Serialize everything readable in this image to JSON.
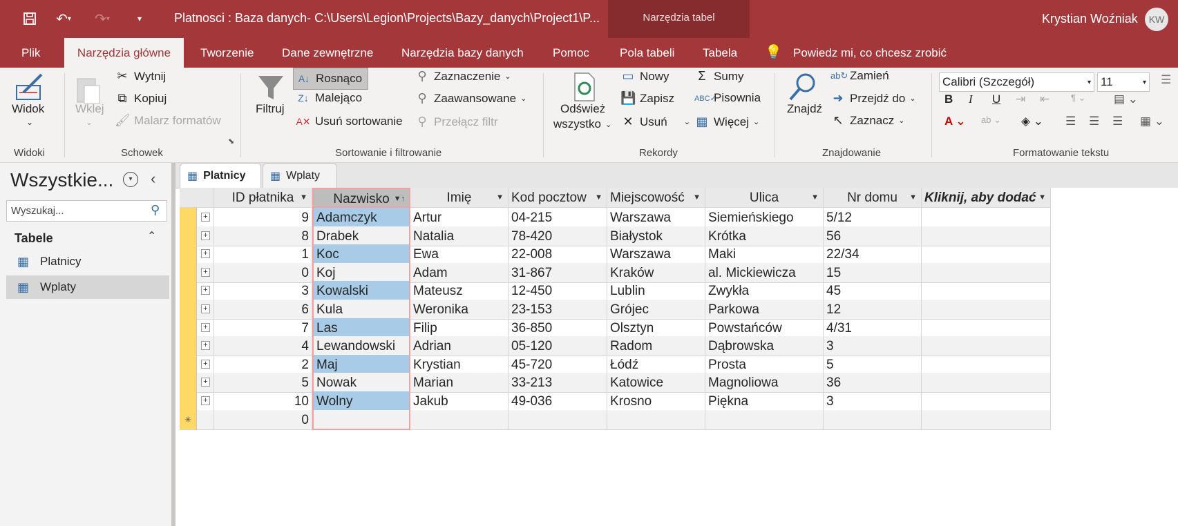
{
  "window": {
    "title": "Platnosci : Baza danych- C:\\Users\\Legion\\Projects\\Bazy_danych\\Project1\\P...",
    "context_group": "Narzędzia tabel",
    "user_name": "Krystian Woźniak",
    "user_initials": "KW"
  },
  "tabs": [
    "Plik",
    "Narzędzia główne",
    "Tworzenie",
    "Dane zewnętrzne",
    "Narzędzia bazy danych",
    "Pomoc",
    "Pola tabeli",
    "Tabela"
  ],
  "tell_me": "Powiedz mi, co chcesz zrobić",
  "ribbon": {
    "views": {
      "widok": "Widok",
      "group": "Widoki"
    },
    "clipboard": {
      "paste": "Wklej",
      "cut": "Wytnij",
      "copy": "Kopiuj",
      "painter": "Malarz formatów",
      "group": "Schowek"
    },
    "sort": {
      "filter": "Filtruj",
      "asc": "Rosnąco",
      "desc": "Malejąco",
      "remove": "Usuń sortowanie",
      "selection": "Zaznaczenie",
      "advanced": "Zaawansowane",
      "toggle": "Przełącz filtr",
      "group": "Sortowanie i filtrowanie"
    },
    "records": {
      "refresh1": "Odśwież",
      "refresh2": "wszystko",
      "new": "Nowy",
      "save": "Zapisz",
      "delete": "Usuń",
      "totals": "Sumy",
      "spelling": "Pisownia",
      "more": "Więcej",
      "group": "Rekordy"
    },
    "find": {
      "find": "Znajdź",
      "replace": "Zamień",
      "goto": "Przejdź do",
      "select": "Zaznacz",
      "group": "Znajdowanie"
    },
    "text": {
      "font": "Calibri (Szczegół)",
      "size": "11",
      "group": "Formatowanie tekstu"
    }
  },
  "nav": {
    "title": "Wszystkie...",
    "search_placeholder": "Wyszukaj...",
    "section": "Tabele",
    "items": [
      "Platnicy",
      "Wplaty"
    ]
  },
  "doc_tabs": [
    "Platnicy",
    "Wplaty"
  ],
  "table": {
    "columns": [
      "ID płatnika",
      "Nazwisko",
      "Imię",
      "Kod pocztow",
      "Miejscowość",
      "Ulica",
      "Nr domu",
      "Kliknij, aby dodać"
    ],
    "rows": [
      [
        "9",
        "Adamczyk",
        "Artur",
        "04-215",
        "Warszawa",
        "Siemieńskiego",
        "5/12"
      ],
      [
        "8",
        "Drabek",
        "Natalia",
        "78-420",
        "Białystok",
        "Krótka",
        "56"
      ],
      [
        "1",
        "Koc",
        "Ewa",
        "22-008",
        "Warszawa",
        "Maki",
        "22/34"
      ],
      [
        "0",
        "Koj",
        "Adam",
        "31-867",
        "Kraków",
        "al. Mickiewicza",
        "15"
      ],
      [
        "3",
        "Kowalski",
        "Mateusz",
        "12-450",
        "Lublin",
        "Zwykła",
        "45"
      ],
      [
        "6",
        "Kula",
        "Weronika",
        "23-153",
        "Grójec",
        "Parkowa",
        "12"
      ],
      [
        "7",
        "Las",
        "Filip",
        "36-850",
        "Olsztyn",
        "Powstańców",
        "4/31"
      ],
      [
        "4",
        "Lewandowski",
        "Adrian",
        "05-120",
        "Radom",
        "Dąbrowska",
        "3"
      ],
      [
        "2",
        "Maj",
        "Krystian",
        "45-720",
        "Łódź",
        "Prosta",
        "5"
      ],
      [
        "5",
        "Nowak",
        "Marian",
        "33-213",
        "Katowice",
        "Magnoliowa",
        "36"
      ],
      [
        "10",
        "Wolny",
        "Jakub",
        "49-036",
        "Krosno",
        "Piękna",
        "3"
      ]
    ],
    "new_row_id": "0"
  }
}
